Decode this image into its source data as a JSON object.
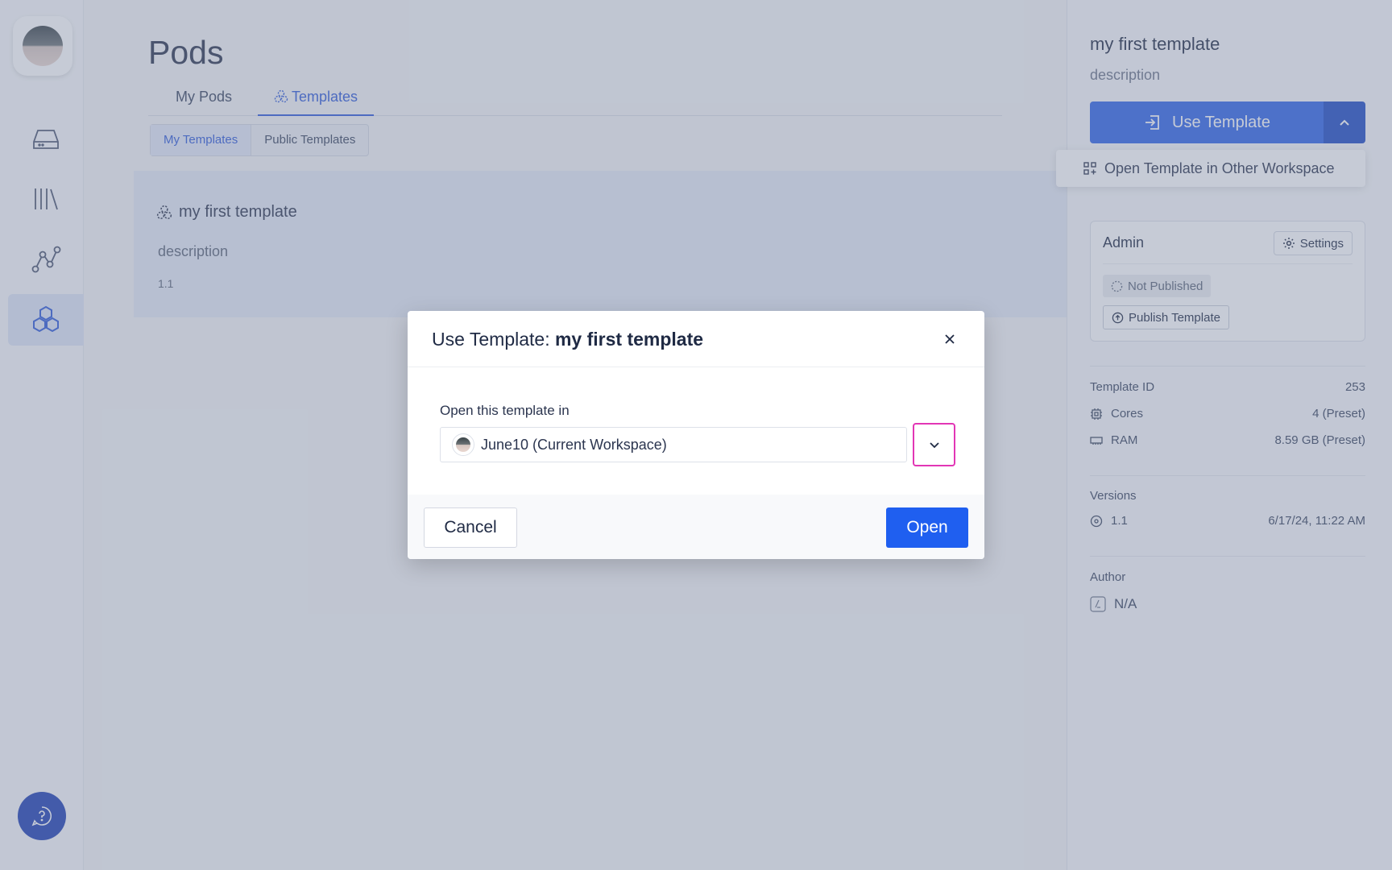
{
  "sidebar": {
    "items": [
      {
        "icon": "drive-icon"
      },
      {
        "icon": "library-icon"
      },
      {
        "icon": "graph-icon"
      },
      {
        "icon": "hexagons-icon",
        "active": true
      }
    ]
  },
  "main": {
    "title": "Pods",
    "tabs": [
      {
        "label": "My Pods"
      },
      {
        "label": "Templates",
        "active": true
      }
    ],
    "subtabs": [
      {
        "label": "My Templates",
        "active": true
      },
      {
        "label": "Public Templates"
      }
    ],
    "card": {
      "title": "my first template",
      "description": "description",
      "version": "1.1"
    }
  },
  "right_panel": {
    "title": "my first template",
    "description": "description",
    "use_template_label": "Use Template",
    "dropdown_item": "Open Template in Other Workspace",
    "admin": {
      "label": "Admin",
      "settings_label": "Settings",
      "status": "Not Published",
      "publish_label": "Publish Template"
    },
    "template_id_label": "Template ID",
    "template_id": "253",
    "cores_label": "Cores",
    "cores_value": "4 (Preset)",
    "ram_label": "RAM",
    "ram_value": "8.59 GB (Preset)",
    "versions_label": "Versions",
    "version": "1.1",
    "version_date": "6/17/24, 11:22 AM",
    "author_label": "Author",
    "author_value": "N/A"
  },
  "modal": {
    "title_prefix": "Use Template: ",
    "title_name": "my first template",
    "field_label": "Open this template in",
    "selected_workspace": "June10 (Current Workspace)",
    "cancel_label": "Cancel",
    "open_label": "Open"
  },
  "colors": {
    "accent": "#2f64e8",
    "primary_button": "#1f5ff0",
    "focus_ring": "#e236b5",
    "help_button": "#1e3fb3"
  }
}
